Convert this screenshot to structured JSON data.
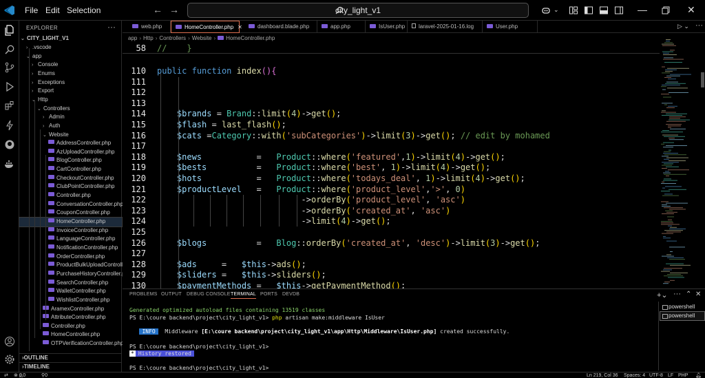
{
  "titlebar": {
    "menus": [
      "File",
      "Edit",
      "Selection"
    ],
    "search_text": "city_light_v1"
  },
  "sidebar": {
    "header": "EXPLORER",
    "root": "CITY_LIGHT_V1",
    "items": [
      {
        "label": ".vscode",
        "depth": 1,
        "type": "folder-closed"
      },
      {
        "label": "app",
        "depth": 1,
        "type": "folder-open"
      },
      {
        "label": "Console",
        "depth": 2,
        "type": "folder-closed"
      },
      {
        "label": "Enums",
        "depth": 2,
        "type": "folder-closed"
      },
      {
        "label": "Exceptions",
        "depth": 2,
        "type": "folder-closed"
      },
      {
        "label": "Export",
        "depth": 2,
        "type": "folder-closed"
      },
      {
        "label": "Http",
        "depth": 2,
        "type": "folder-open"
      },
      {
        "label": "Controllers",
        "depth": 3,
        "type": "folder-open"
      },
      {
        "label": "Admin",
        "depth": 4,
        "type": "folder-closed"
      },
      {
        "label": "Auth",
        "depth": 4,
        "type": "folder-closed"
      },
      {
        "label": "Website",
        "depth": 4,
        "type": "folder-open"
      },
      {
        "label": "AddressController.php",
        "depth": 5,
        "type": "file"
      },
      {
        "label": "AzUploadController.php",
        "depth": 5,
        "type": "file"
      },
      {
        "label": "BlogController.php",
        "depth": 5,
        "type": "file"
      },
      {
        "label": "CartController.php",
        "depth": 5,
        "type": "file"
      },
      {
        "label": "CheckoutController.php",
        "depth": 5,
        "type": "file"
      },
      {
        "label": "ClubPointController.php",
        "depth": 5,
        "type": "file"
      },
      {
        "label": "Controller.php",
        "depth": 5,
        "type": "file"
      },
      {
        "label": "ConversationController.php",
        "depth": 5,
        "type": "file"
      },
      {
        "label": "CouponController.php",
        "depth": 5,
        "type": "file"
      },
      {
        "label": "HomeController.php",
        "depth": 5,
        "type": "file",
        "selected": true
      },
      {
        "label": "InvoiceController.php",
        "depth": 5,
        "type": "file"
      },
      {
        "label": "LanguageController.php",
        "depth": 5,
        "type": "file"
      },
      {
        "label": "NotificationController.php",
        "depth": 5,
        "type": "file"
      },
      {
        "label": "OrderController.php",
        "depth": 5,
        "type": "file"
      },
      {
        "label": "ProductBulkUploadController.p...",
        "depth": 5,
        "type": "file"
      },
      {
        "label": "PurchaseHistoryController.php",
        "depth": 5,
        "type": "file"
      },
      {
        "label": "SearchController.php",
        "depth": 5,
        "type": "file"
      },
      {
        "label": "WalletController.php",
        "depth": 5,
        "type": "file"
      },
      {
        "label": "WishlistController.php",
        "depth": 5,
        "type": "file"
      },
      {
        "label": "AramexController.php",
        "depth": 4,
        "type": "file"
      },
      {
        "label": "AttributeController.php",
        "depth": 4,
        "type": "file"
      },
      {
        "label": "Controller.php",
        "depth": 4,
        "type": "file"
      },
      {
        "label": "HomeController.php",
        "depth": 4,
        "type": "file"
      },
      {
        "label": "OTPVerificationController.php",
        "depth": 4,
        "type": "file"
      }
    ],
    "sections": [
      "OUTLINE",
      "TIMELINE"
    ]
  },
  "tabs": [
    {
      "label": "web.php",
      "type": "php"
    },
    {
      "label": "HomeController.php",
      "type": "php",
      "active": true
    },
    {
      "label": "dashboard.blade.php",
      "type": "php"
    },
    {
      "label": "app.php",
      "type": "php"
    },
    {
      "label": "IsUser.php",
      "type": "php"
    },
    {
      "label": "laravel-2025-01-16.log",
      "type": "log"
    },
    {
      "label": "User.php",
      "type": "php"
    }
  ],
  "breadcrumb": [
    "app",
    "Http",
    "Controllers",
    "Website",
    "HomeController.php"
  ],
  "editor": {
    "sticky": {
      "num": "58",
      "text": "//    }"
    },
    "lines": [
      {
        "num": "110",
        "html": "<span class='kw'>public</span> <span class='kw'>function</span> <span class='fn'>index</span><span class='brk'>(){</span>"
      },
      {
        "num": "111",
        "html": ""
      },
      {
        "num": "112",
        "html": ""
      },
      {
        "num": "113",
        "html": ""
      },
      {
        "num": "114",
        "html": "    <span class='var'>$brands</span> = <span class='cls'>Brand</span>::<span class='fn'>limit</span><span class='brk2'>(</span><span class='num'>4</span><span class='brk2'>)</span>-&gt;<span class='fn'>get</span><span class='brk2'>()</span>;"
      },
      {
        "num": "115",
        "html": "    <span class='var'>$flash</span> = <span class='fn'>last_flash</span><span class='brk2'>()</span>;"
      },
      {
        "num": "116",
        "html": "    <span class='var'>$cats</span> =<span class='cls'>Category</span>::<span class='fn'>with</span><span class='brk2'>(</span><span class='str'>'subCategories'</span><span class='brk2'>)</span>-&gt;<span class='fn'>limit</span><span class='brk2'>(</span><span class='num'>3</span><span class='brk2'>)</span>-&gt;<span class='fn'>get</span><span class='brk2'>()</span>; <span class='cmt'>// edit by mohamed</span>"
      },
      {
        "num": "117",
        "html": ""
      },
      {
        "num": "118",
        "html": "    <span class='var'>$news</span>           =   <span class='cls'>Product</span>::<span class='fn'>where</span><span class='brk2'>(</span><span class='str'>'featured'</span>,<span class='num'>1</span><span class='brk2'>)</span>-&gt;<span class='fn'>limit</span><span class='brk2'>(</span><span class='num'>4</span><span class='brk2'>)</span>-&gt;<span class='fn'>get</span><span class='brk2'>()</span>;"
      },
      {
        "num": "119",
        "html": "    <span class='var'>$bests</span>          =   <span class='cls'>Product</span>::<span class='fn'>where</span><span class='brk2'>(</span><span class='str'>'best'</span>, <span class='num'>1</span><span class='brk2'>)</span>-&gt;<span class='fn'>limit</span><span class='brk2'>(</span><span class='num'>4</span><span class='brk2'>)</span>-&gt;<span class='fn'>get</span><span class='brk2'>()</span>;"
      },
      {
        "num": "120",
        "html": "    <span class='var'>$hots</span>           =   <span class='cls'>Product</span>::<span class='fn'>where</span><span class='brk2'>(</span><span class='str'>'todays_deal'</span>, <span class='num'>1</span><span class='brk2'>)</span>-&gt;<span class='fn'>limit</span><span class='brk2'>(</span><span class='num'>4</span><span class='brk2'>)</span>-&gt;<span class='fn'>get</span><span class='brk2'>()</span>;"
      },
      {
        "num": "121",
        "html": "    <span class='var'>$productLevel</span>   =   <span class='cls'>Product</span>::<span class='fn'>where</span><span class='brk2'>(</span><span class='str'>'product_level'</span>,<span class='str'>'&gt;'</span>, <span class='num'>0</span><span class='brk2'>)</span>"
      },
      {
        "num": "122",
        "html": "                             -&gt;<span class='fn'>orderBy</span><span class='brk2'>(</span><span class='str'>'product_level'</span>, <span class='str'>'asc'</span><span class='brk2'>)</span>"
      },
      {
        "num": "123",
        "html": "                             -&gt;<span class='fn'>orderBy</span><span class='brk2'>(</span><span class='str'>'created_at'</span>, <span class='str'>'asc'</span><span class='brk2'>)</span>"
      },
      {
        "num": "124",
        "html": "                             -&gt;<span class='fn'>limit</span><span class='brk2'>(</span><span class='num'>4</span><span class='brk2'>)</span>-&gt;<span class='fn'>get</span><span class='brk2'>()</span>;"
      },
      {
        "num": "125",
        "html": ""
      },
      {
        "num": "126",
        "html": "    <span class='var'>$blogs</span>          =   <span class='cls'>Blog</span>::<span class='fn'>orderBy</span><span class='brk2'>(</span><span class='str'>'created_at'</span>, <span class='str'>'desc'</span><span class='brk2'>)</span>-&gt;<span class='fn'>limit</span><span class='brk2'>(</span><span class='num'>3</span><span class='brk2'>)</span>-&gt;<span class='fn'>get</span><span class='brk2'>()</span>;"
      },
      {
        "num": "127",
        "html": ""
      },
      {
        "num": "128",
        "html": "    <span class='var'>$ads</span>     =   <span class='var'>$this</span>-&gt;<span class='fn'>ads</span><span class='brk2'>()</span>;"
      },
      {
        "num": "129",
        "html": "    <span class='var'>$sliders</span> =   <span class='var'>$this</span>-&gt;<span class='fn'>sliders</span><span class='brk2'>()</span>;"
      },
      {
        "num": "130",
        "html": "    <span class='var'>$paymentMethods</span> =   <span class='var'>$this</span>-&gt;<span class='fn'>getPaymentMethod</span><span class='brk2'>()</span>;"
      }
    ]
  },
  "panel": {
    "tabs": [
      "PROBLEMS",
      "OUTPUT",
      "DEBUG CONSOLE",
      "TERMINAL",
      "PORTS",
      "DEVDB"
    ],
    "active_tab": "TERMINAL",
    "terminal": {
      "line1": "Generated optimized autoload files containing 13519 classes",
      "line2_prompt": "PS E:\\coure backend\\project\\city_light_v1> ",
      "line2_cmd": "php",
      "line2_rest": " artisan make:middleware IsUser",
      "info_badge": "INFO",
      "info_pre": "  Middleware ",
      "info_path": "[E:\\coure backend\\project\\city_light_v1\\app\\Http\\Middleware\\IsUser.php]",
      "info_post": " created successfully.",
      "line4": "PS E:\\coure backend\\project\\city_light_v1>",
      "history_badge": "*",
      "history_text": "History restored",
      "line6": "PS E:\\coure backend\\project\\city_light_v1>"
    },
    "terminals": [
      "powershell",
      "powershell"
    ]
  },
  "statusbar": {
    "problems": "0",
    "warnings": "0",
    "ports": "0",
    "position": "Ln 219, Col 36",
    "spaces": "Spaces: 4",
    "encoding": "UTF-8",
    "eol": "LF",
    "language": "PHP"
  }
}
